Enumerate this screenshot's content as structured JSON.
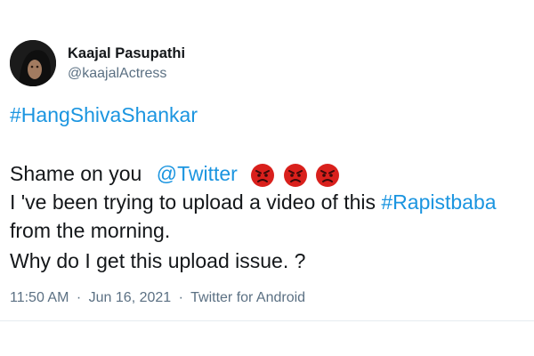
{
  "author": {
    "name": "Kaajal Pasupathi",
    "handle": "@kaajalActress"
  },
  "tweet": {
    "hashtag": "#HangShivaShankar",
    "line1_text": "Shame on you",
    "line1_mention": "@Twitter",
    "line1_emojis": [
      "angry-face",
      "angry-face",
      "angry-face"
    ],
    "line2_text": "I 've been trying to upload a video of this ",
    "line2_hashtag": "#Rapistbaba",
    "line3_text": "from the morning.",
    "line4_text": "Why do I get this upload issue. ?"
  },
  "meta": {
    "time": "11:50 AM",
    "separator": "·",
    "date": "Jun 16, 2021",
    "source": "Twitter for Android"
  },
  "colors": {
    "link": "#1b95e0",
    "text": "#14171a",
    "secondary": "#5b7083",
    "emoji_red": "#d9201c"
  }
}
